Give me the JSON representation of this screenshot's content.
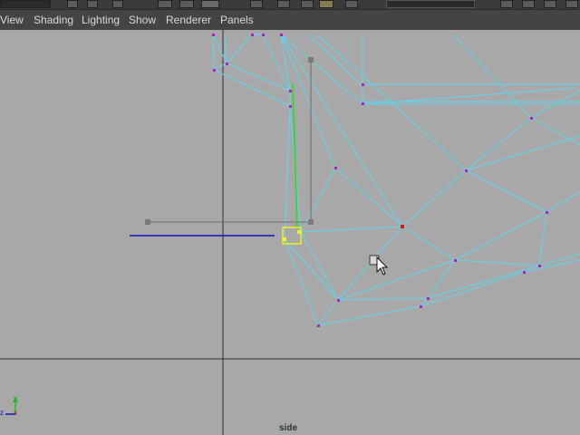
{
  "menubar": {
    "items": [
      {
        "id": "view",
        "label": "View"
      },
      {
        "id": "shading",
        "label": "Shading"
      },
      {
        "id": "lighting",
        "label": "Lighting"
      },
      {
        "id": "show",
        "label": "Show"
      },
      {
        "id": "renderer",
        "label": "Renderer"
      },
      {
        "id": "panels",
        "label": "Panels"
      }
    ]
  },
  "viewport": {
    "camera_label": "side",
    "axis_labels": {
      "y": "y",
      "z": "z",
      "x": "x"
    }
  },
  "colors": {
    "background": "#a8a8a8",
    "menubar": "#444444",
    "wire": "#5fd6ee",
    "vertex": "#b020c0",
    "selected_vertex": "#d01818",
    "manip_handle": "#f0f020",
    "axis_grid": "#2e2e2e",
    "manip_y": "#20e020",
    "manip_z": "#1010c0"
  },
  "icons": {
    "toolbar": [
      "render-frame-icon",
      "render-settings-icon",
      "render-view-icon",
      "select-tool-icon",
      "lasso-tool-icon",
      "paint-select-icon",
      "snap-grid-icon",
      "snap-curve-icon",
      "snap-point-icon",
      "snap-plane-icon"
    ],
    "cursor": "select-cursor-icon"
  }
}
